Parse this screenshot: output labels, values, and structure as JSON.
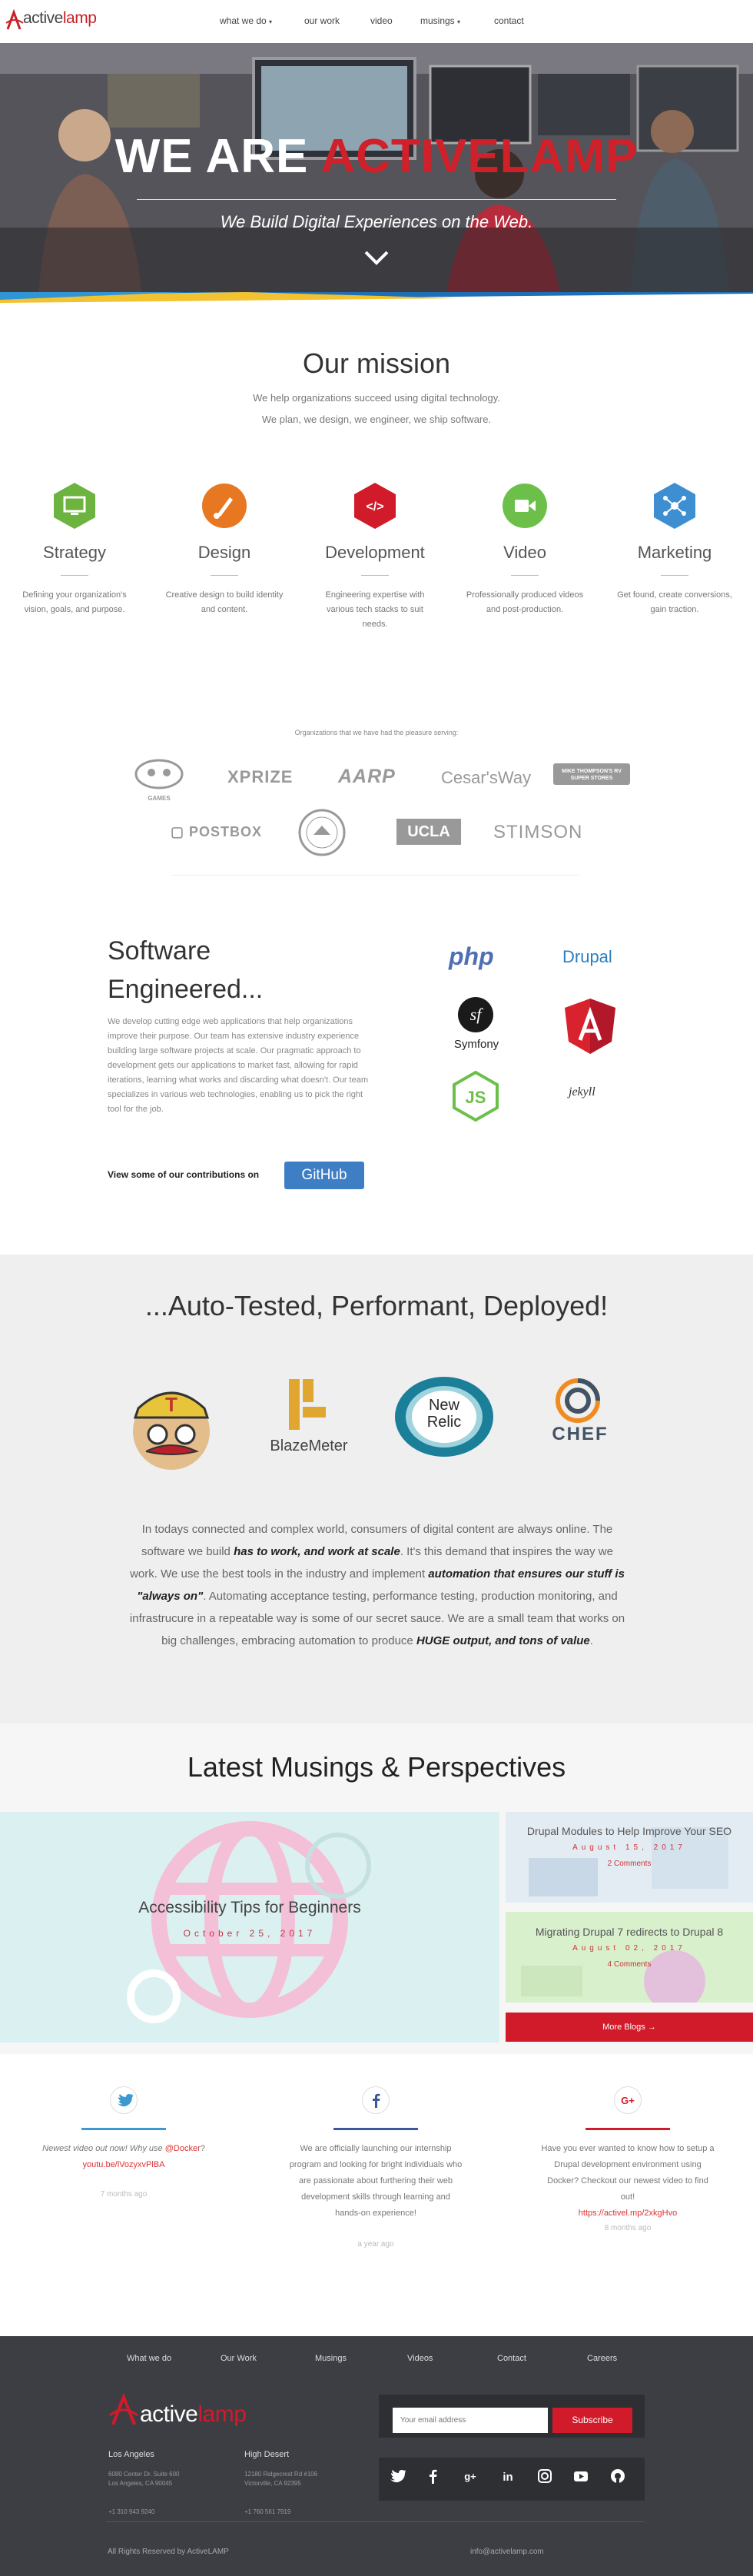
{
  "nav": {
    "logo_part1": "active",
    "logo_part2": "lamp",
    "items": [
      "what we do",
      "our work",
      "video",
      "musings",
      "contact"
    ]
  },
  "hero": {
    "title_part1": "WE ARE ",
    "title_part2": "ACTIVELAMP",
    "subtitle": "We Build Digital Experiences on the Web."
  },
  "mission": {
    "title": "Our mission",
    "line1": "We help organizations succeed using digital technology.",
    "line2": "We plan, we design, we engineer, we ship software.",
    "services": [
      {
        "title": "Strategy",
        "desc": "Defining your organization's vision, goals, and purpose.",
        "color": "#6cb33f",
        "icon": "monitor-icon"
      },
      {
        "title": "Design",
        "desc": "Creative design to build identity and content.",
        "color": "#e87722",
        "icon": "paintbrush-icon"
      },
      {
        "title": "Development",
        "desc": "Engineering expertise with various tech stacks to suit needs.",
        "color": "#d11b2a",
        "icon": "code-icon"
      },
      {
        "title": "Video",
        "desc": "Professionally produced videos and post-production.",
        "color": "#6cc04a",
        "icon": "video-camera-icon"
      },
      {
        "title": "Marketing",
        "desc": "Get found, create conversions, gain traction.",
        "color": "#3d8fd1",
        "icon": "network-icon"
      }
    ]
  },
  "orgs": {
    "label": "Organizations that we have had the pleasure serving:",
    "logos": [
      "GAMES",
      "XPRIZE",
      "AARP",
      "Cesar'sWay",
      "MIKE THOMPSON'S RV SUPER STORES",
      "POSTBOX",
      "UNIVERSITY SEAL",
      "UCLA",
      "STIMSON"
    ]
  },
  "software": {
    "title": "Software Engineered...",
    "text": "We develop cutting edge web applications that help organizations improve their purpose. Our team has extensive industry experience building large software projects at scale. Our pragmatic approach to development gets our applications to market fast, allowing for rapid iterations, learning what works and discarding what doesn't. Our team specializes in various web technologies, enabling us to pick the right tool for the job.",
    "gh_label": "View some of our contributions on",
    "gh_button": "GitHub",
    "tech": [
      "php",
      "Drupal",
      "Symfony",
      "jekyll"
    ]
  },
  "auto": {
    "title": "...Auto-Tested, Performant, Deployed!",
    "tools": [
      "BlazeMeter",
      "New",
      "Relic",
      "CHEF"
    ],
    "p1": "In todays connected and complex world, consumers of digital content are always online. The software we build ",
    "b1": "has to work, and work at scale",
    "p2": ". It's this demand that inspires the way we work. We use the best tools in the industry and implement ",
    "b2": "automation that ensures our stuff is \"always on\"",
    "p3": ". Automating acceptance testing, performance testing, production monitoring, and infrastrucure in a repeatable way is some of our secret sauce. We are a small team that works on big challenges, embracing automation to produce ",
    "b3": "HUGE output, and tons of value",
    "p4": "."
  },
  "blog": {
    "title": "Latest Musings & Perspectives",
    "main": {
      "title": "Accessibility Tips for Beginners",
      "date": "October 25, 2017"
    },
    "side": [
      {
        "title": "Drupal Modules to Help Improve Your SEO",
        "date": "August 15, 2017",
        "comments": "2 Comments"
      },
      {
        "title": "Migrating Drupal 7 redirects to Drupal 8",
        "date": "August 02, 2017",
        "comments": "4 Comments"
      }
    ],
    "more": "More Blogs →"
  },
  "social": [
    {
      "icon": "twitter-icon",
      "color": "#3d9ad1",
      "text_pre": "Newest video out now! Why use ",
      "link1": "@Docker",
      "text_mid": "? ",
      "link2": "youtu.be/lVozyxvPlBA",
      "time": "7 months ago"
    },
    {
      "icon": "facebook-icon",
      "color": "#3b5998",
      "text": "We are officially launching our internship program and looking for bright individuals who are passionate about furthering their web development skills through learning and hands-on experience!",
      "time": "a year ago"
    },
    {
      "icon": "google-plus-icon",
      "color": "#d11b2a",
      "text": "Have you ever wanted to know how to setup a Drupal development environment using Docker? Checkout our newest video to find out!",
      "link": "https://activel.mp/2xkgHvo",
      "time": "8 months ago"
    }
  ],
  "footer": {
    "links": [
      "What we do",
      "Our Work",
      "Musings",
      "Videos",
      "Contact",
      "Careers"
    ],
    "logo_part1": "active",
    "logo_part2": "lamp",
    "offices": [
      {
        "city": "Los Angeles",
        "addr1": "6080 Center Dr. Suite 600",
        "addr2": "Los Angeles, CA 90045",
        "phone": "+1 310 943 9240"
      },
      {
        "city": "High Desert",
        "addr1": "12180 Ridgecrest Rd #106",
        "addr2": "Victorville, CA 92395",
        "phone": "+1 760 561 7919"
      }
    ],
    "email_placeholder": "Your email address",
    "subscribe": "Subscribe",
    "copyright": "All Rights Reserved by ActiveLAMP",
    "email": "info@activelamp.com"
  }
}
